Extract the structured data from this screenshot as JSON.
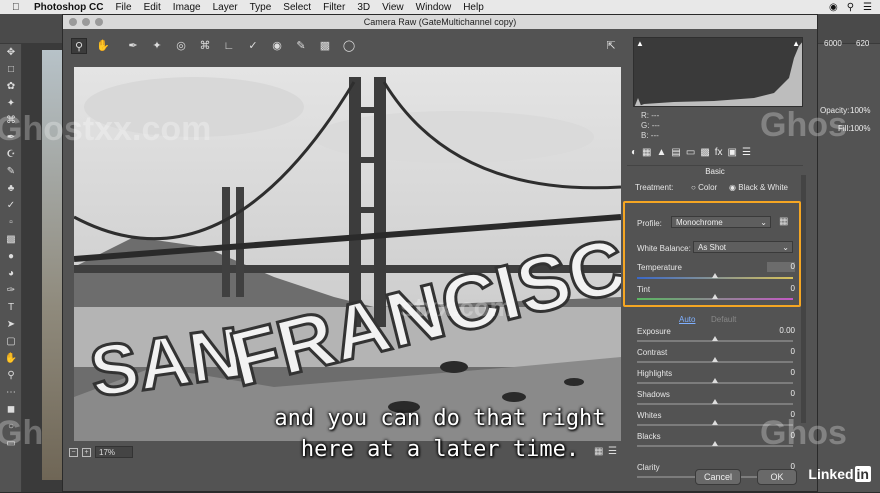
{
  "menubar": {
    "app": "Photoshop CC",
    "items": [
      "File",
      "Edit",
      "Image",
      "Layer",
      "Type",
      "Select",
      "Filter",
      "3D",
      "View",
      "Window",
      "Help"
    ]
  },
  "dialog": {
    "title": "Camera Raw (GateMultichannel copy)",
    "zoom": "17%",
    "cancel_label": "Cancel",
    "ok_label": "OK"
  },
  "right_panel_bg": {
    "opacity_label": "Opacity:",
    "opacity_value": "100%",
    "fill_label": "Fill:",
    "fill_value": "100%",
    "ruler_a": "6000",
    "ruler_b": "620"
  },
  "readout": {
    "r_label": "R:",
    "r_value": "---",
    "g_label": "G:",
    "g_value": "---",
    "b_label": "B:",
    "b_value": "---"
  },
  "basic": {
    "section_title": "Basic",
    "treatment_label": "Treatment:",
    "treatment_color": "Color",
    "treatment_bw": "Black & White",
    "profile_label": "Profile:",
    "profile_value": "Monochrome",
    "wb_label": "White Balance:",
    "wb_value": "As Shot",
    "auto_label": "Auto",
    "default_label": "Default",
    "sliders": [
      {
        "label": "Temperature",
        "value": "0"
      },
      {
        "label": "Tint",
        "value": "0"
      },
      {
        "label": "Exposure",
        "value": "0.00"
      },
      {
        "label": "Contrast",
        "value": "0"
      },
      {
        "label": "Highlights",
        "value": "0"
      },
      {
        "label": "Shadows",
        "value": "0"
      },
      {
        "label": "Whites",
        "value": "0"
      },
      {
        "label": "Blacks",
        "value": "0"
      },
      {
        "label": "Clarity",
        "value": "0"
      }
    ]
  },
  "image": {
    "text_line1": "SAN",
    "text_line2": "FRANCISCO"
  },
  "caption": {
    "line1": "and you can do that right",
    "line2": "here at a later time."
  },
  "watermarks": {
    "left": "Ghostxx.com",
    "mid": "stxx.com",
    "right_top": "Ghos",
    "right_bottom": "Ghos",
    "left_bottom": "Gh"
  },
  "brand": {
    "linkedin_a": "Linked",
    "linkedin_b": "in"
  }
}
